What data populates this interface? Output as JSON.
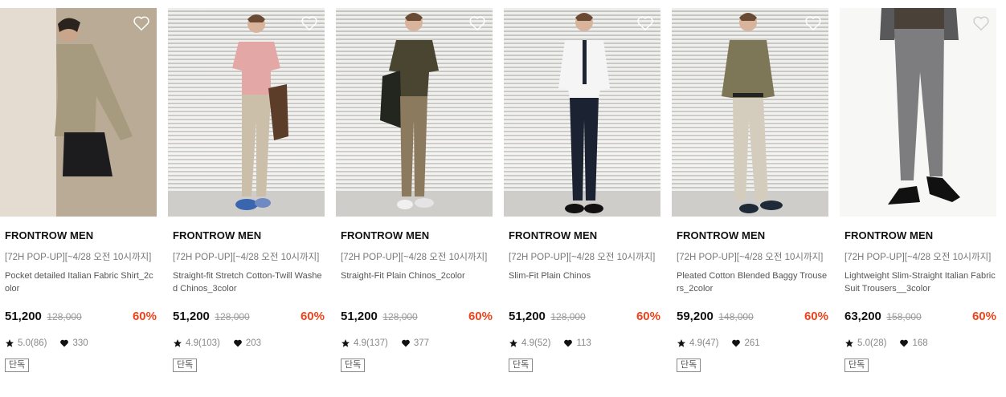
{
  "products": [
    {
      "brand": "FRONTROW MEN",
      "promo": "[72H POP-UP][~4/28 오전 10시까지]",
      "name": "Pocket detailed Italian Fabric Shirt_2color",
      "price": "51,200",
      "original_price": "128,000",
      "discount": "60%",
      "rating": "5.0(86)",
      "likes": "330",
      "tag": "단독",
      "palette": {
        "bg": "#cbbfae",
        "top": "#a69a7f",
        "bottom": "#1c1c1e"
      }
    },
    {
      "brand": "FRONTROW MEN",
      "promo": "[72H POP-UP][~4/28 오전 10시까지]",
      "name": "Straight-fit Stretch Cotton-Twill Washed Chinos_3color",
      "price": "51,200",
      "original_price": "128,000",
      "discount": "60%",
      "rating": "4.9(103)",
      "likes": "203",
      "tag": "단독",
      "palette": {
        "bg": "#e6e5e1",
        "top": "#e3a7a6",
        "bottom": "#cbbfa9"
      }
    },
    {
      "brand": "FRONTROW MEN",
      "promo": "[72H POP-UP][~4/28 오전 10시까지]",
      "name": "Straight-Fit Plain Chinos_2color",
      "price": "51,200",
      "original_price": "128,000",
      "discount": "60%",
      "rating": "4.9(137)",
      "likes": "377",
      "tag": "단독",
      "palette": {
        "bg": "#e6e5e1",
        "top": "#4a4531",
        "bottom": "#8c7a5f"
      }
    },
    {
      "brand": "FRONTROW MEN",
      "promo": "[72H POP-UP][~4/28 오전 10시까지]",
      "name": "Slim-Fit Plain Chinos",
      "price": "51,200",
      "original_price": "128,000",
      "discount": "60%",
      "rating": "4.9(52)",
      "likes": "113",
      "tag": "단독",
      "palette": {
        "bg": "#e6e5e1",
        "top": "#f5f5f5",
        "bottom": "#1b2231"
      }
    },
    {
      "brand": "FRONTROW MEN",
      "promo": "[72H POP-UP][~4/28 오전 10시까지]",
      "name": "Pleated Cotton Blended Baggy Trousers_2color",
      "price": "59,200",
      "original_price": "148,000",
      "discount": "60%",
      "rating": "4.9(47)",
      "likes": "261",
      "tag": "단독",
      "palette": {
        "bg": "#e6e5e1",
        "top": "#7d7757",
        "bottom": "#d4cdbe"
      }
    },
    {
      "brand": "FRONTROW MEN",
      "promo": "[72H POP-UP][~4/28 오전 10시까지]",
      "name": "Lightweight Slim-Straight Italian Fabric Suit Trousers__3color",
      "price": "63,200",
      "original_price": "158,000",
      "discount": "60%",
      "rating": "5.0(28)",
      "likes": "168",
      "tag": "단독",
      "palette": {
        "bg": "#f7f7f5",
        "top": "#59595b",
        "bottom": "#7d7d7f"
      }
    }
  ],
  "icons": {
    "wishlist": "heart-outline-icon",
    "rating": "star-icon",
    "likes": "heart-filled-icon"
  },
  "colors": {
    "discount": "#f0431b",
    "text": "#111111",
    "muted": "#888888"
  }
}
